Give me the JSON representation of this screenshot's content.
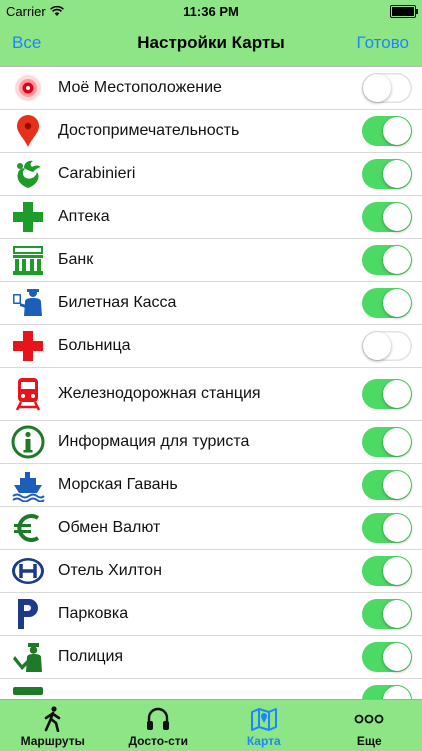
{
  "status_bar": {
    "carrier": "Carrier",
    "time": "11:36 PM"
  },
  "nav": {
    "left": "Все",
    "title": "Настройки Карты",
    "right": "Готово"
  },
  "items": [
    {
      "label": "Моё Местоположение",
      "icon": "location-icon",
      "on": false
    },
    {
      "label": "Достопримечательность",
      "icon": "map-pin-icon",
      "on": true
    },
    {
      "label": "Carabinieri",
      "icon": "carabinieri-icon",
      "on": true
    },
    {
      "label": "Аптека",
      "icon": "pharmacy-icon",
      "on": true
    },
    {
      "label": "Банк",
      "icon": "bank-icon",
      "on": true
    },
    {
      "label": "Билетная Касса",
      "icon": "ticket-office-icon",
      "on": true
    },
    {
      "label": "Больница",
      "icon": "hospital-icon",
      "on": false
    },
    {
      "label": "Железнодорожная станция",
      "icon": "train-icon",
      "on": true
    },
    {
      "label": "Информация для туриста",
      "icon": "info-icon",
      "on": true
    },
    {
      "label": "Морская Гавань",
      "icon": "ship-icon",
      "on": true
    },
    {
      "label": "Обмен Валют",
      "icon": "euro-icon",
      "on": true
    },
    {
      "label": "Отель Хилтон",
      "icon": "hilton-icon",
      "on": true
    },
    {
      "label": "Парковка",
      "icon": "parking-icon",
      "on": true
    },
    {
      "label": "Полиция",
      "icon": "police-icon",
      "on": true
    },
    {
      "label": "",
      "icon": "partial-icon",
      "on": true
    }
  ],
  "tabs": [
    {
      "label": "Маршруты",
      "icon": "walker-icon",
      "active": false
    },
    {
      "label": "Досто-сти",
      "icon": "headphones-icon",
      "active": false
    },
    {
      "label": "Карта",
      "icon": "map-icon",
      "active": true
    },
    {
      "label": "Еще",
      "icon": "more-icon",
      "active": false
    }
  ],
  "colors": {
    "accent": "#1b86ff",
    "bar": "#8ee585",
    "toggle_on": "#4cd964"
  }
}
